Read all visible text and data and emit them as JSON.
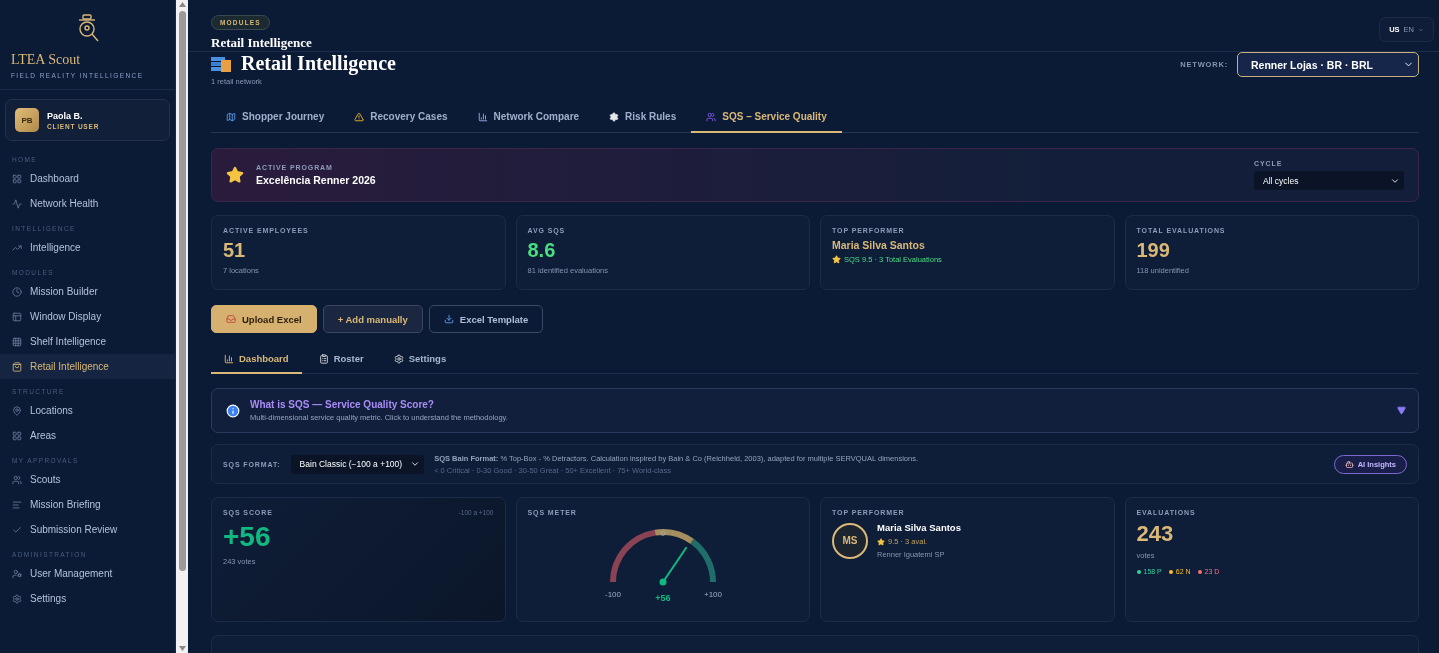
{
  "sidebar": {
    "brand": {
      "title": "LTEA Scout",
      "subtitle": "FIELD REALITY INTELLIGENCE"
    },
    "user": {
      "initials": "PB",
      "name": "Paola B.",
      "role": "CLIENT USER"
    },
    "sections": [
      {
        "label": "HOME",
        "items": [
          {
            "label": "Dashboard",
            "selected": false
          },
          {
            "label": "Network Health",
            "selected": false
          }
        ]
      },
      {
        "label": "INTELLIGENCE",
        "items": [
          {
            "label": "Intelligence",
            "selected": false
          }
        ]
      },
      {
        "label": "MODULES",
        "items": [
          {
            "label": "Mission Builder",
            "selected": false
          },
          {
            "label": "Window Display",
            "selected": false
          },
          {
            "label": "Shelf Intelligence",
            "selected": false
          },
          {
            "label": "Retail Intelligence",
            "selected": true
          }
        ]
      },
      {
        "label": "STRUCTURE",
        "items": [
          {
            "label": "Locations",
            "selected": false
          },
          {
            "label": "Areas",
            "selected": false
          }
        ]
      },
      {
        "label": "MY APPROVALS",
        "items": [
          {
            "label": "Scouts",
            "selected": false
          },
          {
            "label": "Mission Briefing",
            "selected": false
          },
          {
            "label": "Submission Review",
            "selected": false
          }
        ]
      },
      {
        "label": "ADMINISTRATION",
        "items": [
          {
            "label": "User Management",
            "selected": false
          },
          {
            "label": "Settings",
            "selected": false
          }
        ]
      }
    ]
  },
  "topbar": {
    "badge": "MODULES",
    "title": "Retail Intelligence",
    "language": {
      "flag": "US",
      "code": "EN"
    }
  },
  "page": {
    "title": "Retail Intelligence",
    "subtitle": "1 retail network",
    "network": {
      "label": "NETWORK:",
      "value": "Renner Lojas · BR · BRL"
    }
  },
  "tabs": [
    {
      "label": "Shopper Journey",
      "selected": false
    },
    {
      "label": "Recovery Cases",
      "selected": false
    },
    {
      "label": "Network Compare",
      "selected": false
    },
    {
      "label": "Risk Rules",
      "selected": false
    },
    {
      "label": "SQS – Service Quality",
      "selected": true
    }
  ],
  "program": {
    "label": "ACTIVE PROGRAM",
    "name": "Excelência Renner 2026",
    "cycle": {
      "label": "CYCLE",
      "value": "All cycles"
    }
  },
  "stats": [
    {
      "kind": "number",
      "label": "ACTIVE EMPLOYEES",
      "value": "51",
      "note": "7 locations",
      "color": "#d9b878"
    },
    {
      "kind": "number",
      "label": "AVG SQS",
      "value": "8.6",
      "note": "81 identified evaluations",
      "color": "#4ade80"
    },
    {
      "kind": "person",
      "label": "TOP PERFORMER",
      "value": "Maria Silva Santos",
      "note": "SQS 9.5 · 3 Total Evaluations",
      "color": "#d9b878"
    },
    {
      "kind": "number",
      "label": "TOTAL EVALUATIONS",
      "value": "199",
      "note": "118 unidentified",
      "color": "#d9b878"
    }
  ],
  "actions": [
    {
      "label": "Upload Excel",
      "kind": "primary"
    },
    {
      "label": "+ Add manually",
      "kind": "secondary"
    },
    {
      "label": "Excel Template",
      "kind": "outline"
    }
  ],
  "subtabs": [
    {
      "label": "Dashboard",
      "selected": true
    },
    {
      "label": "Roster",
      "selected": false
    },
    {
      "label": "Settings",
      "selected": false
    }
  ],
  "info": {
    "title": "What is SQS — Service Quality Score?",
    "text": "Multi-dimensional service quality metric. Click to understand the methodology.",
    "expanded": false
  },
  "format": {
    "label": "SQS FORMAT:",
    "value": "Bain Classic (−100 a +100)",
    "description": "**SQS Bain Format:** % Top-Box - % Detractors. Calculation inspired by Bain & Co (Reichheld, 2003), adapted for multiple SERVQUAL dimensions.",
    "scale": "< 0 Critical · 0-30 Good · 30-50 Great · 50+ Excellent · 75+ World-class",
    "ai_button": "AI Insights"
  },
  "score": {
    "label": "SQS SCORE",
    "range": "-100 a +100",
    "value": "+56",
    "note": "243 votes"
  },
  "meter": {
    "label": "SQS METER",
    "level": 0.78,
    "min": "-100",
    "mid": "0",
    "max": "+100",
    "reading": "+56"
  },
  "performer": {
    "label": "TOP PERFORMER",
    "initials": "MS",
    "name": "Maria Silva Santos",
    "rating": "9.5 · 3 aval.",
    "location": "Renner Iguatemi SP"
  },
  "evaluations": {
    "label": "EVALUATIONS",
    "value": "243",
    "unit": "votes",
    "breakdown": [
      {
        "label": "158 P",
        "color": "#34d399"
      },
      {
        "label": "62 N",
        "color": "#fbbf24"
      },
      {
        "label": "23 D",
        "color": "#f87171"
      }
    ]
  }
}
